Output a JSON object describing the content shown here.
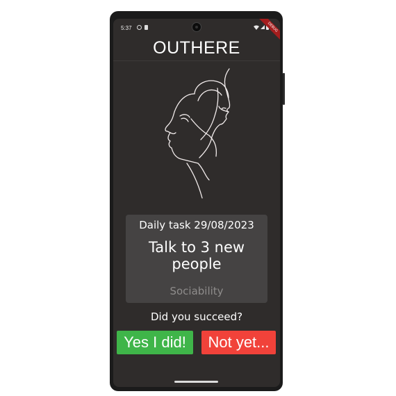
{
  "status_bar": {
    "time": "5:37",
    "ribbon": "DEBUG"
  },
  "app": {
    "title": "OUTHERE"
  },
  "task": {
    "header": "Daily task 29/08/2023",
    "text": "Talk to 3 new people",
    "category": "Sociability"
  },
  "prompt": {
    "question": "Did you succeed?"
  },
  "actions": {
    "yes_label": "Yes I did!",
    "no_label": "Not yet..."
  },
  "colors": {
    "screen_bg": "#2f2c2b",
    "card_bg": "#454343",
    "yes": "#3fb549",
    "no": "#f1423a",
    "category_text": "#8e8c8b"
  },
  "icons": [
    "camera-icon",
    "wifi-icon",
    "signal-icon",
    "battery-icon",
    "face-line-art-icon"
  ]
}
